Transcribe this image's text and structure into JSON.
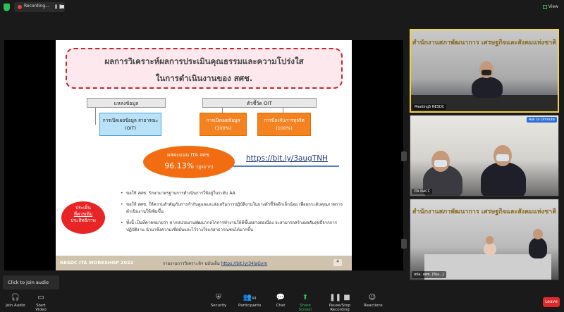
{
  "topbar": {
    "recording_label": "Recording...",
    "view_label": "View"
  },
  "slide": {
    "title_line1": "ผลการวิเคราะห์ผลการประเมินคุณธรรมและความโปร่งใส",
    "title_line2": "ในการดำเนินงานของ สศช.",
    "header_source": "แหล่งข้อมูล",
    "header_indicator": "ตัวชี้วัด OIT",
    "cell_oit": "การเปิดเผยข้อมูล สาธารณะ (OIT)",
    "cell_ind1_l1": "การเปิดเผยข้อมูล",
    "cell_ind1_l2": "(100%)",
    "cell_ind2_l1": "การป้องกันการทุจริต",
    "cell_ind2_l2": "(100%)",
    "score_label": "ผลคะแนน ITA สศช.",
    "score_value": "96.13%",
    "score_grade": "(สูงมาก)",
    "link": "https://bit.ly/3augTNH",
    "red_oval_l1": "ประเด็น",
    "red_oval_l2": "ที่ควรเพิ่ม",
    "red_oval_l3": "ประสิทธิภาพ",
    "bullets": [
      "ขอให้ สศช. รักษามาตรฐานการดำเนินการให้อยู่ในระดับ AA",
      "ขอให้ สศช. ให้ความสำคัญกับการกำกับดูแลและส่งเสริมการปฏิบัติงานในบางตัวชี้วัดอีกเล็กน้อย เพื่อยกระดับคุณภาพการดำเนินงานให้เพิ่มขึ้น",
      "ทั้งนี้ เป็นที่คาดหมายว่า หากหน่วยงานพัฒนากลไกการทำงานให้ดีขึ้นอย่างต่อเนื่อง จะสามารถสร้างผลสัมฤทธิ์จากการปฏิบัติงาน นำมาซึ่งความเชื่อมั่นและไว้วางใจแก่สาธารณชนได้มากขึ้น"
    ],
    "footer_workshop": "NESDC ITA WORKSHOP 2022",
    "footer_report": "รายงานการวิเคราะห์ฯ ฉบับเต็ม",
    "footer_link": "https://bit.ly/34laGym",
    "footer_page": "4"
  },
  "participants": {
    "tile1_name": "Meeting5 NESDC",
    "tile1_wall": "สำนักงานสภาพัฒนาการ เศรษฐกิจและสังคมแห่งชาติ",
    "tile2_name": "ITA NACC",
    "tile2_button": "Ask to Unmute",
    "tile3_name": "สปค. สศช. (ห้อง...)",
    "tile3_wall": "สำนักงานสภาพัฒนาการ เศรษฐกิจและสังคมแห่งชาติ"
  },
  "tooltip": "Click to join audio",
  "bottombar": {
    "join_audio": "Join Audio",
    "start_video": "Start Video",
    "security": "Security",
    "participants": "Participants",
    "participants_count": "49",
    "chat": "Chat",
    "share_screen": "Share Screen",
    "pause_stop_recording": "Pause/Stop Recording",
    "reactions": "Reactions",
    "leave": "Leave"
  },
  "colors": {
    "accent_green": "#2dbd5a",
    "leave_red": "#e02828",
    "slide_orange": "#f58220",
    "active_speaker": "#f3d340"
  }
}
